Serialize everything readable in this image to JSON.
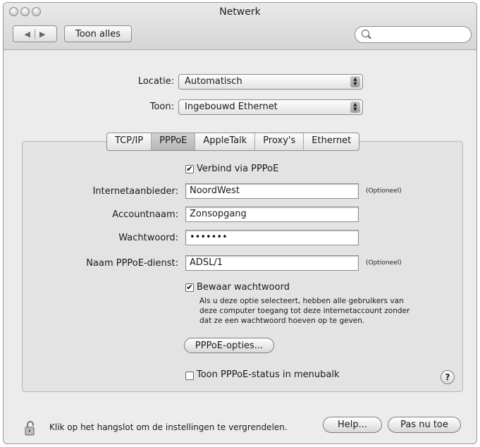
{
  "window": {
    "title": "Netwerk"
  },
  "toolbar": {
    "show_all": "Toon alles",
    "search_placeholder": ""
  },
  "location": {
    "label": "Locatie:",
    "value": "Automatisch"
  },
  "show": {
    "label": "Toon:",
    "value": "Ingebouwd Ethernet"
  },
  "tabs": [
    {
      "label": "TCP/IP"
    },
    {
      "label": "PPPoE"
    },
    {
      "label": "AppleTalk"
    },
    {
      "label": "Proxy's"
    },
    {
      "label": "Ethernet"
    }
  ],
  "pppoe": {
    "connect_label": "Verbind via PPPoE",
    "connect_checked": true,
    "provider_label": "Internetaanbieder:",
    "provider_value": "NoordWest",
    "provider_optional": "(Optioneel)",
    "account_label": "Accountnaam:",
    "account_value": "Zonsopgang",
    "password_label": "Wachtwoord:",
    "password_value": "•••••••",
    "service_label": "Naam PPPoE-dienst:",
    "service_value": "ADSL/1",
    "service_optional": "(Optioneel)",
    "save_password_label": "Bewaar wachtwoord",
    "save_password_checked": true,
    "save_password_help_1": "Als u deze optie selecteert, hebben alle gebruikers van",
    "save_password_help_2": "deze computer toegang tot deze internetaccount zonder",
    "save_password_help_3": "dat ze een wachtwoord hoeven op te geven.",
    "options_button": "PPPoE-opties...",
    "status_label": "Toon PPPoE-status in menubalk",
    "status_checked": false
  },
  "footer": {
    "lock_text": "Klik op het hangslot om de instellingen te vergrendelen.",
    "help_button": "Help...",
    "apply_button": "Pas nu toe"
  },
  "misc": {
    "help_glyph": "?",
    "check_glyph": "✔"
  }
}
